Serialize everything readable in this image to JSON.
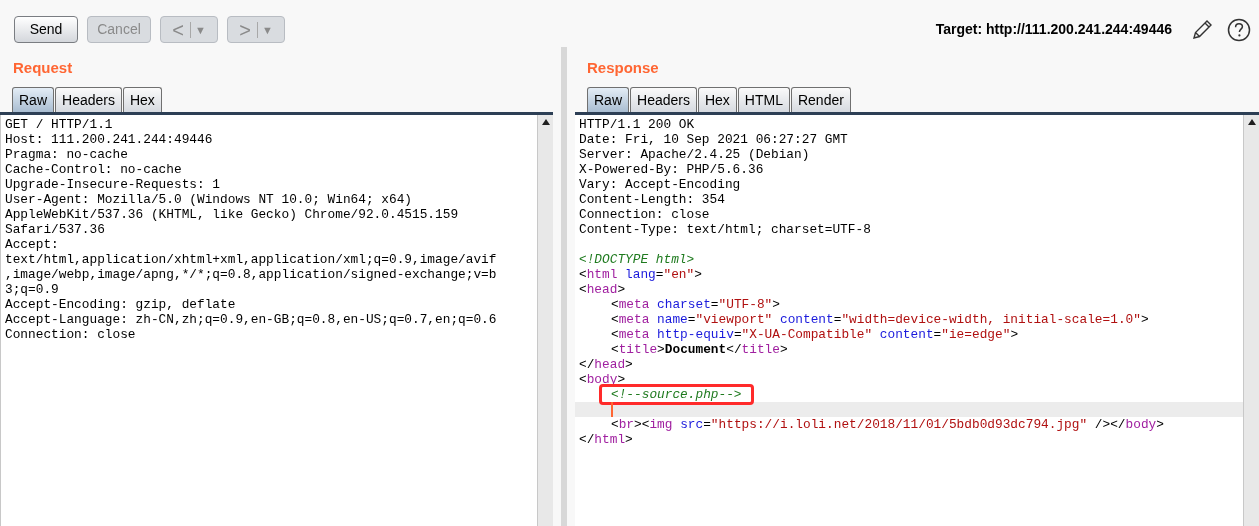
{
  "toolbar": {
    "buttons": [
      {
        "kind": "text",
        "label": "Send",
        "disabled": false
      },
      {
        "kind": "text",
        "label": "Cancel",
        "disabled": true
      },
      {
        "kind": "split",
        "label": "<",
        "menu": "▼",
        "disabled": true
      },
      {
        "kind": "split",
        "label": ">",
        "menu": "▼",
        "disabled": true
      }
    ],
    "target": "Target: http://111.200.241.244:49446"
  },
  "request": {
    "title": "Request",
    "tabs": [
      {
        "label": "Raw",
        "selected": true
      },
      {
        "label": "Headers",
        "selected": false
      },
      {
        "label": "Hex",
        "selected": false
      }
    ],
    "lines": [
      "GET / HTTP/1.1",
      "Host: 111.200.241.244:49446",
      "Pragma: no-cache",
      "Cache-Control: no-cache",
      "Upgrade-Insecure-Requests: 1",
      "User-Agent: Mozilla/5.0 (Windows NT 10.0; Win64; x64)",
      "AppleWebKit/537.36 (KHTML, like Gecko) Chrome/92.0.4515.159",
      "Safari/537.36",
      "Accept:",
      "text/html,application/xhtml+xml,application/xml;q=0.9,image/avif",
      ",image/webp,image/apng,*/*;q=0.8,application/signed-exchange;v=b",
      "3;q=0.9",
      "Accept-Encoding: gzip, deflate",
      "Accept-Language: zh-CN,zh;q=0.9,en-GB;q=0.8,en-US;q=0.7,en;q=0.6",
      "Connection: close"
    ]
  },
  "response": {
    "title": "Response",
    "tabs": [
      {
        "label": "Raw",
        "selected": true
      },
      {
        "label": "Headers",
        "selected": false
      },
      {
        "label": "Hex",
        "selected": false
      },
      {
        "label": "HTML",
        "selected": false
      },
      {
        "label": "Render",
        "selected": false
      }
    ],
    "headers": [
      "HTTP/1.1 200 OK",
      "Date: Fri, 10 Sep 2021 06:27:27 GMT",
      "Server: Apache/2.4.25 (Debian)",
      "X-Powered-By: PHP/5.6.36",
      "Vary: Accept-Encoding",
      "Content-Length: 354",
      "Connection: close",
      "Content-Type: text/html; charset=UTF-8"
    ],
    "body": [
      {
        "indented": false,
        "boxed": false,
        "current": false,
        "tokens": [
          {
            "kind": "comment",
            "text": "<!DOCTYPE html>"
          }
        ]
      },
      {
        "indented": false,
        "boxed": false,
        "current": false,
        "tokens": [
          {
            "kind": "punct",
            "text": "<"
          },
          {
            "kind": "tag",
            "text": "html"
          },
          {
            "kind": "attr",
            "text": " lang"
          },
          {
            "kind": "punct",
            "text": "="
          },
          {
            "kind": "value",
            "text": "\"en\""
          },
          {
            "kind": "punct",
            "text": ">"
          }
        ]
      },
      {
        "indented": false,
        "boxed": false,
        "current": false,
        "tokens": [
          {
            "kind": "punct",
            "text": "<"
          },
          {
            "kind": "tag",
            "text": "head"
          },
          {
            "kind": "punct",
            "text": ">"
          }
        ]
      },
      {
        "indented": true,
        "boxed": false,
        "current": false,
        "tokens": [
          {
            "kind": "punct",
            "text": "<"
          },
          {
            "kind": "tag",
            "text": "meta"
          },
          {
            "kind": "attr",
            "text": " charset"
          },
          {
            "kind": "punct",
            "text": "="
          },
          {
            "kind": "value",
            "text": "\"UTF-8\""
          },
          {
            "kind": "punct",
            "text": ">"
          }
        ]
      },
      {
        "indented": true,
        "boxed": false,
        "current": false,
        "tokens": [
          {
            "kind": "punct",
            "text": "<"
          },
          {
            "kind": "tag",
            "text": "meta"
          },
          {
            "kind": "attr",
            "text": " name"
          },
          {
            "kind": "punct",
            "text": "="
          },
          {
            "kind": "value",
            "text": "\"viewport\""
          },
          {
            "kind": "attr",
            "text": " content"
          },
          {
            "kind": "punct",
            "text": "="
          },
          {
            "kind": "value",
            "text": "\"width=device-width, initial-scale=1.0\""
          },
          {
            "kind": "punct",
            "text": ">"
          }
        ]
      },
      {
        "indented": true,
        "boxed": false,
        "current": false,
        "tokens": [
          {
            "kind": "punct",
            "text": "<"
          },
          {
            "kind": "tag",
            "text": "meta"
          },
          {
            "kind": "attr",
            "text": " http-equiv"
          },
          {
            "kind": "punct",
            "text": "="
          },
          {
            "kind": "value",
            "text": "\"X-UA-Compatible\""
          },
          {
            "kind": "attr",
            "text": " content"
          },
          {
            "kind": "punct",
            "text": "="
          },
          {
            "kind": "value",
            "text": "\"ie=edge\""
          },
          {
            "kind": "punct",
            "text": ">"
          }
        ]
      },
      {
        "indented": true,
        "boxed": false,
        "current": false,
        "tokens": [
          {
            "kind": "punct",
            "text": "<"
          },
          {
            "kind": "tag",
            "text": "title"
          },
          {
            "kind": "punct",
            "text": ">"
          },
          {
            "kind": "bold",
            "text": "Document"
          },
          {
            "kind": "punct",
            "text": "</"
          },
          {
            "kind": "tag",
            "text": "title"
          },
          {
            "kind": "punct",
            "text": ">"
          }
        ]
      },
      {
        "indented": false,
        "boxed": false,
        "current": false,
        "tokens": [
          {
            "kind": "punct",
            "text": "</"
          },
          {
            "kind": "tag",
            "text": "head"
          },
          {
            "kind": "punct",
            "text": ">"
          }
        ]
      },
      {
        "indented": false,
        "boxed": false,
        "current": false,
        "tokens": [
          {
            "kind": "punct",
            "text": "<"
          },
          {
            "kind": "tag",
            "text": "body"
          },
          {
            "kind": "punct",
            "text": ">"
          }
        ]
      },
      {
        "indented": true,
        "boxed": true,
        "current": false,
        "tokens": [
          {
            "kind": "comment",
            "text": "<!--source.php-->"
          }
        ]
      },
      {
        "indented": true,
        "boxed": false,
        "current": true
      },
      {
        "indented": true,
        "boxed": false,
        "current": false,
        "tokens": [
          {
            "kind": "punct",
            "text": "<"
          },
          {
            "kind": "tag",
            "text": "br"
          },
          {
            "kind": "punct",
            "text": "><"
          },
          {
            "kind": "tag",
            "text": "img"
          },
          {
            "kind": "attr",
            "text": " src"
          },
          {
            "kind": "punct",
            "text": "="
          },
          {
            "kind": "value",
            "text": "\"https://i.loli.net/2018/11/01/5bdb0d93dc794.jpg\""
          },
          {
            "kind": "punct",
            "text": " /></"
          },
          {
            "kind": "tag",
            "text": "body"
          },
          {
            "kind": "punct",
            "text": ">"
          }
        ]
      },
      {
        "indented": false,
        "boxed": false,
        "current": false,
        "tokens": [
          {
            "kind": "punct",
            "text": "</"
          },
          {
            "kind": "tag",
            "text": "html"
          },
          {
            "kind": "punct",
            "text": ">"
          }
        ]
      }
    ]
  }
}
